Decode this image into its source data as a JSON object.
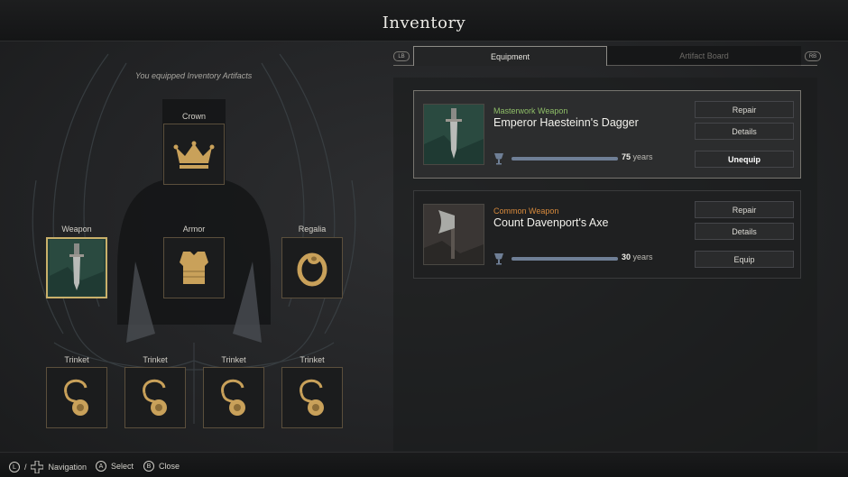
{
  "header": {
    "title": "Inventory"
  },
  "left": {
    "note": "You equipped Inventory Artifacts",
    "slots": {
      "crown": "Crown",
      "weapon": "Weapon",
      "armor": "Armor",
      "regalia": "Regalia",
      "trinket1": "Trinket",
      "trinket2": "Trinket",
      "trinket3": "Trinket",
      "trinket4": "Trinket"
    }
  },
  "tabs": {
    "left_bumper": "LB",
    "right_bumper": "RB",
    "equipment": "Equipment",
    "artifact_board": "Artifact Board"
  },
  "items": [
    {
      "quality": "Masterwork Weapon",
      "quality_color": "#8fbf68",
      "name": "Emperor Haesteinn's Dagger",
      "years_value": "75",
      "years_unit": "years",
      "durability_fraction": 1.0,
      "buttons": {
        "repair": "Repair",
        "details": "Details",
        "action": "Unequip"
      }
    },
    {
      "quality": "Common Weapon",
      "quality_color": "#d88a3c",
      "name": "Count Davenport's Axe",
      "years_value": "30",
      "years_unit": "years",
      "durability_fraction": 1.0,
      "buttons": {
        "repair": "Repair",
        "details": "Details",
        "action": "Equip"
      }
    }
  ],
  "footer": {
    "nav_stick": "L",
    "navigation": "Navigation",
    "select_key": "A",
    "select": "Select",
    "close_key": "B",
    "close": "Close"
  },
  "colors": {
    "slot_border": "#5b4f3c",
    "gold": "#c9a15a",
    "accent_selected": "#c9b06a"
  }
}
